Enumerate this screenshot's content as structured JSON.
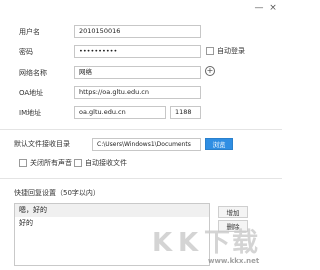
{
  "window": {
    "minimize_glyph": "—",
    "close_glyph": "×"
  },
  "account": {
    "username_label": "用户名",
    "username_value": "2010150016",
    "password_label": "密码",
    "password_value": "••••••••••",
    "auto_login_label": "自动登录",
    "network_label": "网络名称",
    "network_value": "网络",
    "oa_label": "OA地址",
    "oa_value": "https://oa.gltu.edu.cn",
    "im_label": "IM地址",
    "im_value": "oa.gltu.edu.cn",
    "im_port": "1188"
  },
  "files": {
    "dir_label": "默认文件接收目录",
    "dir_value": "C:\\Users\\Windows1\\Documents",
    "browse_label": "浏览",
    "mute_label": "关闭所有声音",
    "auto_receive_label": "自动接收文件"
  },
  "quick_reply": {
    "title": "快捷回复设置（50字以内）",
    "items": [
      "嗯，好的",
      "好的"
    ],
    "add_label": "增加",
    "delete_label": "删除"
  },
  "watermark": {
    "letters": [
      "K",
      "K",
      "下",
      "载"
    ],
    "url": "www.kkx.net"
  },
  "colors": {
    "accent": "#2f8ee3",
    "border": "#c7c7c7"
  }
}
